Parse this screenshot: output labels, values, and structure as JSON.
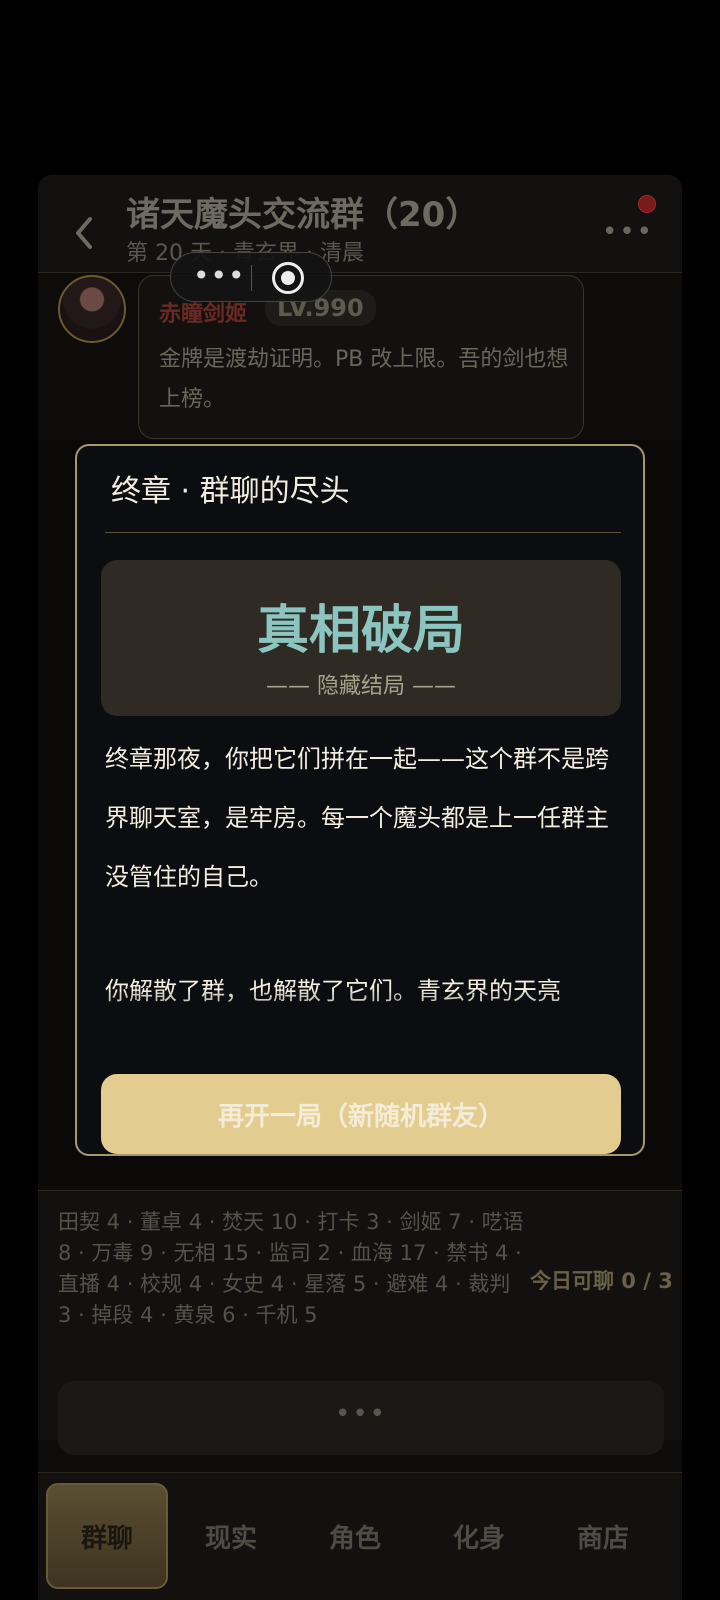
{
  "header": {
    "title": "诸天魔头交流群（20）",
    "subtitle": "第 20 天 · 青玄界 · 清晨"
  },
  "message": {
    "sender": "赤瞳剑姬",
    "level": "LV.990",
    "text": "金牌是渡劫证明。PB 改上限。吾的剑也想上榜。"
  },
  "modal": {
    "title": "终章 · 群聊的尽头",
    "ending_name": "真相破局",
    "ending_tag": "—— 隐藏结局 ——",
    "paragraph1": "终章那夜，你把它们拼在一起——这个群不是跨界聊天室，是牢房。每一个魔头都是上一任群主没管住的自己。",
    "paragraph2": "你解散了群，也解散了它们。青玄界的天亮",
    "restart_label": "再开一局（新随机群友）"
  },
  "roster": {
    "text": "田契 4 · 董卓 4 · 焚天 10 · 打卡 3 · 剑姬 7 · 呓语 8 · 万毒 9 · 无相 15 · 监司 2 · 血海 17 · 禁书 4 · 直播 4 · 校规 4 · 女史 4 · 星落 5 · 避难 4 · 裁判 3 · 掉段 4 · 黄泉 6 · 千机 5",
    "today_label": "今日可聊 0 / 3"
  },
  "tabs": [
    {
      "label": "群聊",
      "active": true
    },
    {
      "label": "现实",
      "active": false
    },
    {
      "label": "角色",
      "active": false
    },
    {
      "label": "化身",
      "active": false
    },
    {
      "label": "商店",
      "active": false
    }
  ],
  "colors": {
    "accent": "#e2cc90",
    "ending_title": "#8cc5bf",
    "modal_border": "#a89868"
  }
}
